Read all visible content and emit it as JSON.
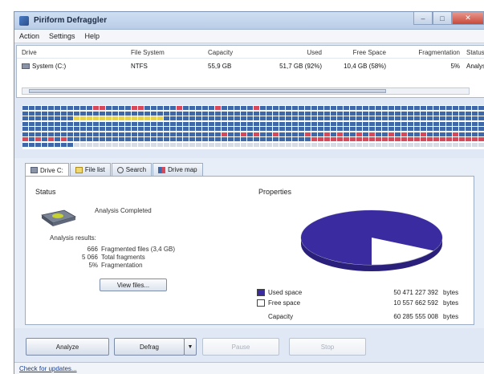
{
  "window": {
    "title": "Piriform Defraggler",
    "controls": [
      "–",
      "□",
      "✕"
    ]
  },
  "menu": [
    "Action",
    "Settings",
    "Help"
  ],
  "drives": {
    "headers": {
      "drive": "Drive",
      "file_system": "File System",
      "capacity": "Capacity",
      "used": "Used",
      "free": "Free Space",
      "fragmentation": "Fragmentation",
      "status": "Status"
    },
    "rows": [
      {
        "drive": "System (C:)",
        "file_system": "NTFS",
        "capacity": "55,9 GB",
        "used": "51,7 GB (92%)",
        "free": "10,4 GB (58%)",
        "fragmentation": "5%",
        "status": "Analys"
      }
    ]
  },
  "blockmap": {
    "colors": {
      "used": "#3f68a8",
      "fragmented": "#d6495a",
      "moved": "#e8d44a",
      "empty": "#d6dbe4"
    }
  },
  "tabs": [
    {
      "label": "Drive C:",
      "icon": "drive-icon"
    },
    {
      "label": "File list",
      "icon": "file-list-icon"
    },
    {
      "label": "Search",
      "icon": "search-icon"
    },
    {
      "label": "Drive map",
      "icon": "drive-map-icon"
    }
  ],
  "status": {
    "heading": "Status",
    "text": "Analysis Completed",
    "results_label": "Analysis results:",
    "results": [
      {
        "value": "666",
        "label": "Fragmented files (3,4 GB)"
      },
      {
        "value": "5 066",
        "label": "Total fragments"
      },
      {
        "value": "5%",
        "label": "Fragmentation"
      }
    ],
    "view_files_label": "View files..."
  },
  "properties": {
    "heading": "Properties",
    "used_label": "Used space",
    "used_bytes": "50 471 227 392",
    "free_label": "Free space",
    "free_bytes": "10 557 662 592",
    "capacity_label": "Capacity",
    "capacity_bytes": "60 285 555 008",
    "unit": "bytes",
    "used_fraction": 0.83,
    "used_color": "#3a2ca0",
    "free_color": "#ffffff"
  },
  "actions": {
    "analyze": "Analyze",
    "defrag": "Defrag",
    "pause": "Pause",
    "stop": "Stop"
  },
  "statusbar": {
    "update_link": "Check for updates..."
  }
}
